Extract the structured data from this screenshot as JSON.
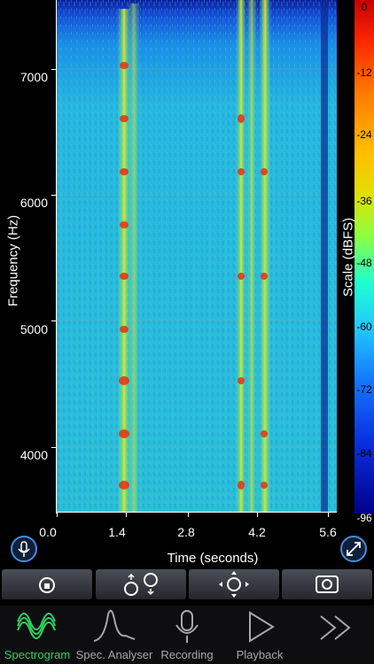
{
  "y_axis": {
    "label": "Frequency (Hz)",
    "ticks": [
      "7000",
      "6000",
      "5000",
      "4000"
    ]
  },
  "x_axis": {
    "label": "Time (seconds)",
    "ticks": [
      "0.0",
      "1.4",
      "2.8",
      "4.2",
      "5.6"
    ]
  },
  "scale": {
    "label": "Scale (dBFS)",
    "ticks": [
      "0",
      "-12",
      "-24",
      "-36",
      "-48",
      "-60",
      "-72",
      "-84",
      "-96"
    ]
  },
  "tabs": [
    {
      "label": "Spectrogram",
      "icon": "waveform-icon",
      "active": true
    },
    {
      "label": "Spec. Analyser",
      "icon": "peak-curve-icon",
      "active": false
    },
    {
      "label": "Recording",
      "icon": "microphone-icon",
      "active": false
    },
    {
      "label": "Playback",
      "icon": "play-icon",
      "active": false
    },
    {
      "label": "",
      "icon": "more-chevrons-icon",
      "active": false
    }
  ],
  "toolbar": [
    {
      "icon": "lock-rotate-icon"
    },
    {
      "icon": "vertical-zoom-icon"
    },
    {
      "icon": "pan-move-icon"
    },
    {
      "icon": "camera-icon"
    }
  ],
  "colors": {
    "accent": "#30d060",
    "tab_inactive": "#a8a8a8",
    "button_ring": "#4a8ad8"
  }
}
